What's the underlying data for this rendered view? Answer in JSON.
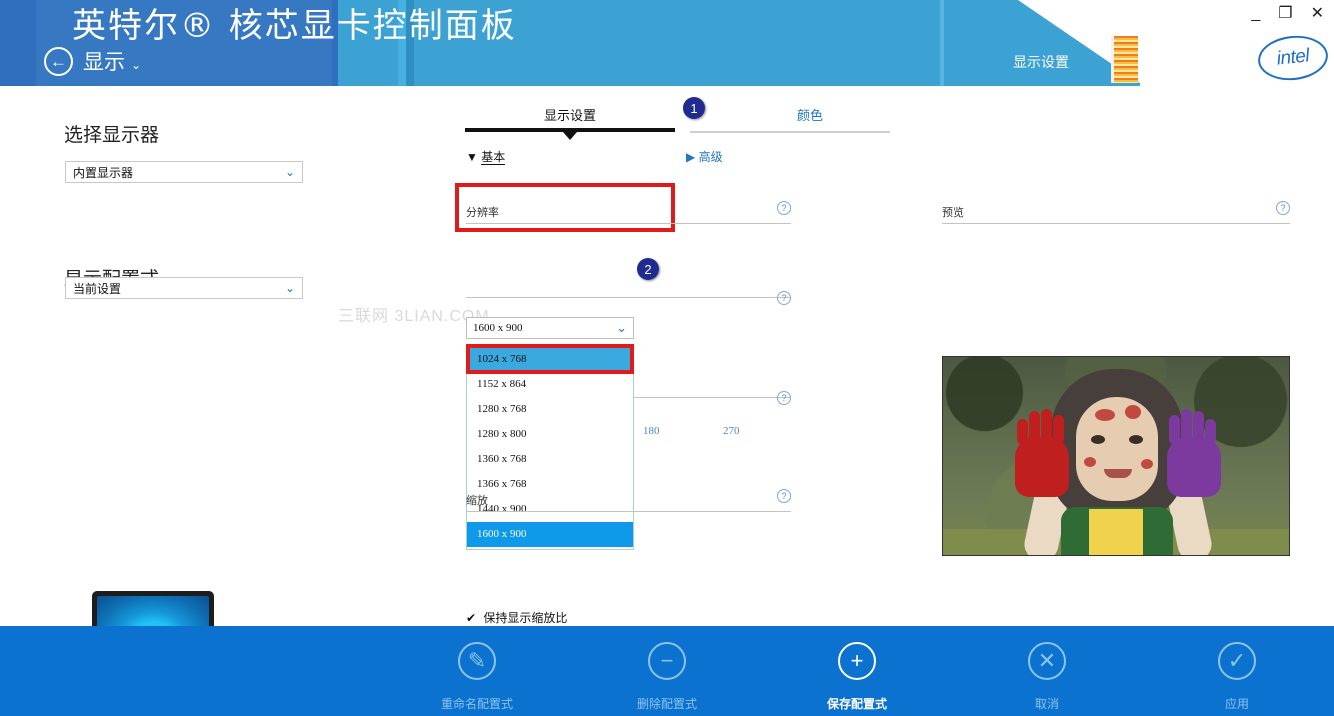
{
  "window": {
    "title": "英特尔® 核芯显卡控制面板",
    "back_label": "显示",
    "back_caret": "⌄",
    "header_badge_label": "显示设置",
    "brand": "intel",
    "minimize": "_",
    "restore": "❐",
    "close": "✕"
  },
  "sidebar": {
    "select_display_heading": "选择显示器",
    "select_display_value": "内置显示器",
    "display_profile_heading": "显示配置式",
    "display_profile_value": "当前设置",
    "chevron": "⌄"
  },
  "tabs": {
    "active": "显示设置",
    "inactive": "颜色",
    "badge_1": "1"
  },
  "toggles": {
    "basic": "基本",
    "basic_marker": "▼",
    "advanced": "高级",
    "advanced_marker": "▶"
  },
  "sections": {
    "resolution_label": "分辨率",
    "rotation_label_hidden": "",
    "scaling_label": "缩放",
    "preview_label": "预览",
    "help_glyph": "?"
  },
  "resolution": {
    "current": "1600 x 900",
    "chevron": "⌄",
    "badge_2": "2",
    "options": [
      {
        "label": "1024 x 768",
        "state": "hover"
      },
      {
        "label": "1152 x 864",
        "state": "normal"
      },
      {
        "label": "1280 x 768",
        "state": "normal"
      },
      {
        "label": "1280 x 800",
        "state": "normal"
      },
      {
        "label": "1360 x 768",
        "state": "normal"
      },
      {
        "label": "1366 x 768",
        "state": "normal"
      },
      {
        "label": "1440 x 900",
        "state": "normal"
      },
      {
        "label": "1600 x 900",
        "state": "selected"
      }
    ]
  },
  "rotation": {
    "value_180": "180",
    "value_270": "270"
  },
  "scaling": {
    "keep_ratio_label": "保持显示缩放比",
    "keep_ratio_check": "✔"
  },
  "watermark": "三联网 3LIAN.COM",
  "toolbar": {
    "buttons": [
      {
        "label": "重命名配置式",
        "icon": "✎",
        "enabled": false
      },
      {
        "label": "删除配置式",
        "icon": "−",
        "enabled": false
      },
      {
        "label": "保存配置式",
        "icon": "+",
        "enabled": true
      },
      {
        "label": "取消",
        "icon": "✕",
        "enabled": false
      },
      {
        "label": "应用",
        "icon": "✓",
        "enabled": false
      }
    ]
  },
  "colors": {
    "header_blue": "#3778c2",
    "header_cyan": "#3da7d9",
    "toolbar_blue": "#0b72d0",
    "accent_link": "#2176c7",
    "annotation_red": "#e01b1b",
    "badge_navy": "#1f2b8f",
    "selected_blue": "#0e9ae8",
    "hover_blue": "#3aa9e0"
  }
}
